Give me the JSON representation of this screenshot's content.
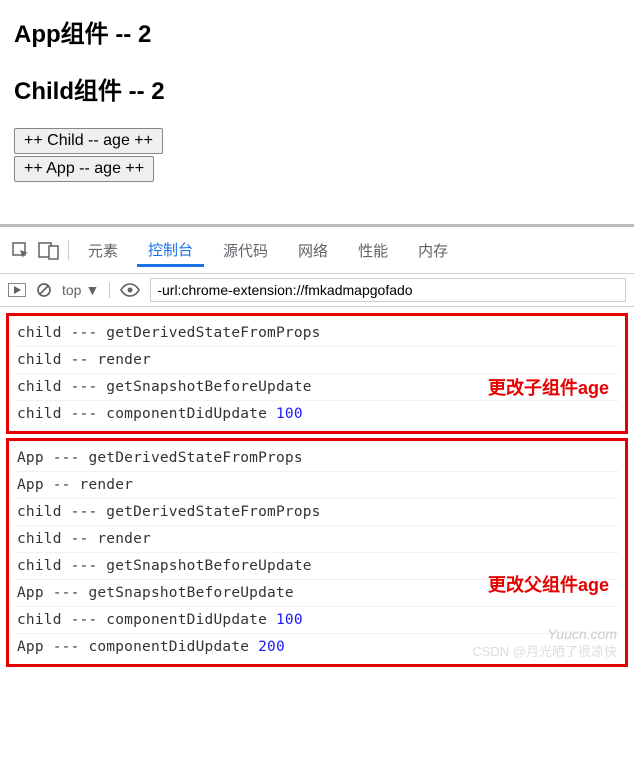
{
  "headings": {
    "app": "App组件 -- 2",
    "child": "Child组件 -- 2"
  },
  "buttons": {
    "child_age": "++ Child -- age ++",
    "app_age": "++ App -- age ++"
  },
  "devtools": {
    "tabs": {
      "elements": "元素",
      "console": "控制台",
      "sources": "源代码",
      "network": "网络",
      "performance": "性能",
      "memory": "内存"
    },
    "context": "top",
    "filter": "-url:chrome-extension://fmkadmapgofado"
  },
  "groups": [
    {
      "label": "更改子组件age",
      "lines": [
        {
          "text": "child --- getDerivedStateFromProps"
        },
        {
          "text": "child -- render"
        },
        {
          "text": "child --- getSnapshotBeforeUpdate"
        },
        {
          "text": "child --- componentDidUpdate ",
          "num": "100"
        }
      ]
    },
    {
      "label": "更改父组件age",
      "lines": [
        {
          "text": "App --- getDerivedStateFromProps"
        },
        {
          "text": "App -- render"
        },
        {
          "text": "child --- getDerivedStateFromProps"
        },
        {
          "text": "child -- render"
        },
        {
          "text": "child --- getSnapshotBeforeUpdate"
        },
        {
          "text": "App --- getSnapshotBeforeUpdate"
        },
        {
          "text": "child --- componentDidUpdate ",
          "num": "100"
        },
        {
          "text": "App --- componentDidUpdate ",
          "num": "200"
        }
      ]
    }
  ],
  "watermarks": {
    "site": "Yuucn.com",
    "author": "CSDN @月光晒了很凉快"
  }
}
